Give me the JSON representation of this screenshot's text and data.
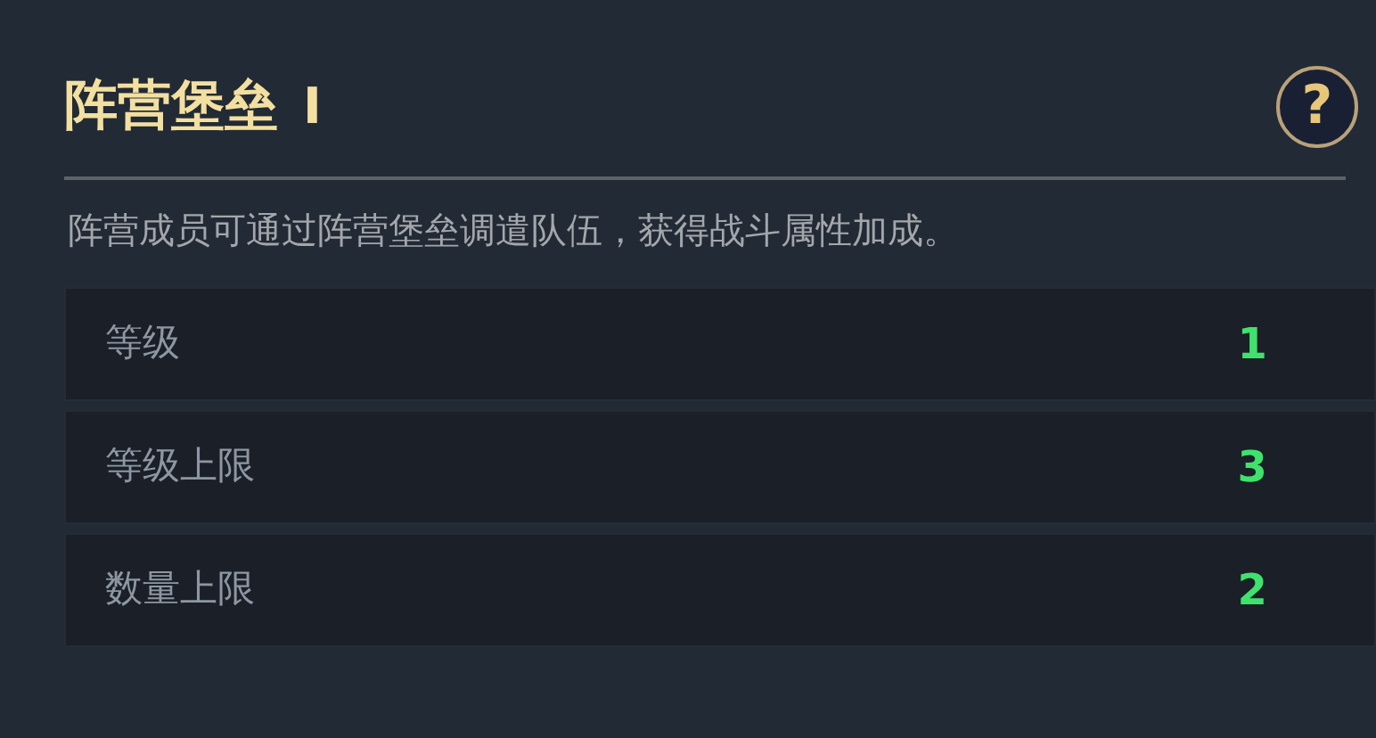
{
  "header": {
    "title": "阵营堡垒",
    "tier": "I",
    "help": "?"
  },
  "description": "阵营成员可通过阵营堡垒调遣队伍，获得战斗属性加成。",
  "stats": [
    {
      "label": "等级",
      "value": "1"
    },
    {
      "label": "等级上限",
      "value": "3"
    },
    {
      "label": "数量上限",
      "value": "2"
    }
  ]
}
